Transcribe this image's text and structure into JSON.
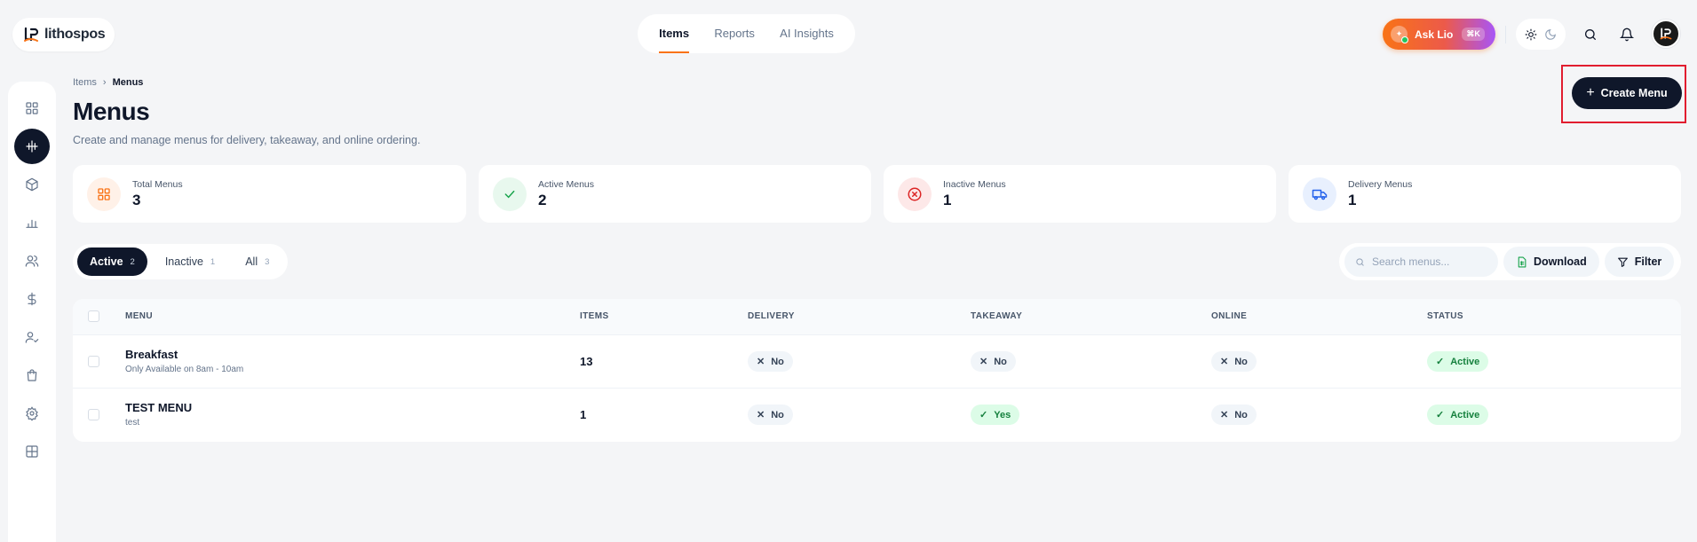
{
  "brand": {
    "name": "lithospos"
  },
  "topnav": {
    "tabs": [
      {
        "label": "Items",
        "active": true
      },
      {
        "label": "Reports",
        "active": false
      },
      {
        "label": "AI Insights",
        "active": false
      }
    ]
  },
  "asklio": {
    "label": "Ask Lio",
    "shortcut": "⌘K"
  },
  "header_icons": [
    "sun-icon",
    "moon-icon",
    "search-icon",
    "bell-icon"
  ],
  "sidebar": {
    "items": [
      {
        "icon": "dashboard-grid-icon",
        "active": false
      },
      {
        "icon": "menu-items-icon",
        "active": true
      },
      {
        "icon": "box-icon",
        "active": false
      },
      {
        "icon": "bar-chart-icon",
        "active": false
      },
      {
        "icon": "users-icon",
        "active": false
      },
      {
        "icon": "dollar-icon",
        "active": false
      },
      {
        "icon": "user-check-icon",
        "active": false
      },
      {
        "icon": "shopping-bag-icon",
        "active": false
      },
      {
        "icon": "settings-icon",
        "active": false
      },
      {
        "icon": "layout-icon",
        "active": false
      }
    ]
  },
  "breadcrumb": {
    "parent": "Items",
    "separator": "›",
    "current": "Menus"
  },
  "page": {
    "title": "Menus",
    "subtitle": "Create and manage menus for delivery, takeaway, and online ordering.",
    "create_button": "Create Menu"
  },
  "stats": [
    {
      "label": "Total Menus",
      "value": "3",
      "icon": "grid-icon",
      "color": "#f97316"
    },
    {
      "label": "Active Menus",
      "value": "2",
      "icon": "check-icon",
      "color": "#16a34a"
    },
    {
      "label": "Inactive Menus",
      "value": "1",
      "icon": "x-circle-icon",
      "color": "#dc2626"
    },
    {
      "label": "Delivery Menus",
      "value": "1",
      "icon": "truck-icon",
      "color": "#2563eb"
    }
  ],
  "filter_tabs": [
    {
      "label": "Active",
      "count": "2",
      "active": true
    },
    {
      "label": "Inactive",
      "count": "1",
      "active": false
    },
    {
      "label": "All",
      "count": "3",
      "active": false
    }
  ],
  "toolbar": {
    "search_placeholder": "Search menus...",
    "download": "Download",
    "filter": "Filter"
  },
  "table": {
    "columns": [
      "MENU",
      "ITEMS",
      "DELIVERY",
      "TAKEAWAY",
      "ONLINE",
      "STATUS"
    ],
    "rows": [
      {
        "name": "Breakfast",
        "description": "Only Available on 8am - 10am",
        "items": "13",
        "delivery": "No",
        "takeaway": "No",
        "online": "No",
        "status": "Active"
      },
      {
        "name": "TEST MENU",
        "description": "test",
        "items": "1",
        "delivery": "No",
        "takeaway": "Yes",
        "online": "No",
        "status": "Active"
      }
    ]
  },
  "colors": {
    "accent": "#f97316",
    "dark": "#0f172a",
    "success": "#15803d",
    "highlight": "#e11d2f"
  }
}
